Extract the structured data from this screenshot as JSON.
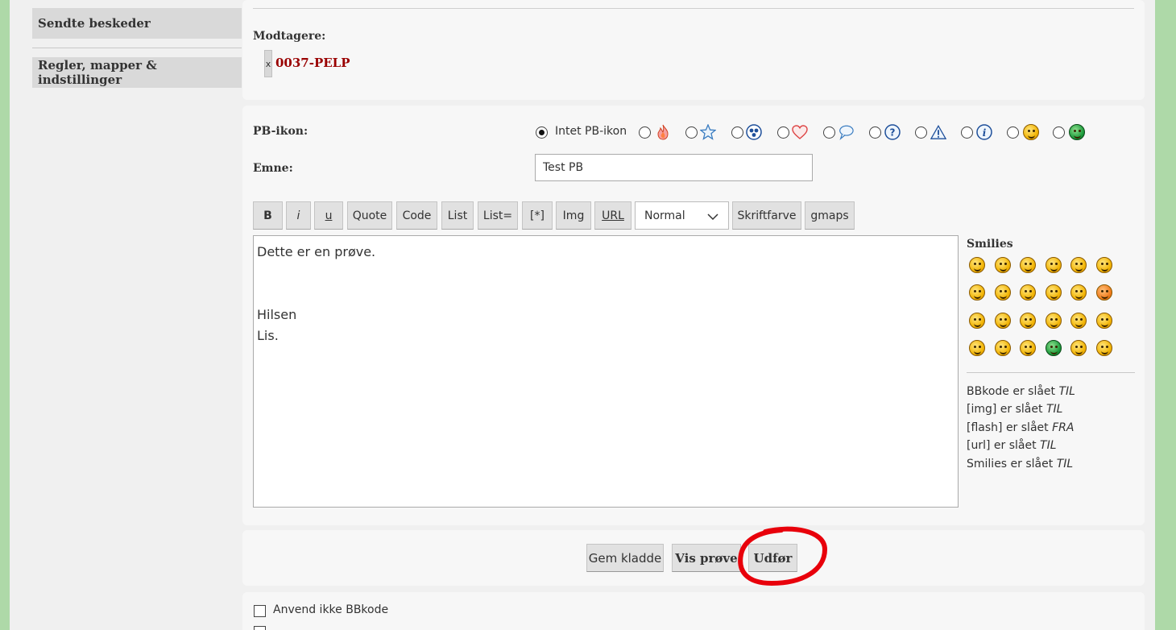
{
  "sidebar": {
    "items": [
      {
        "label": "Sendte beskeder"
      },
      {
        "label": "Regler, mapper & indstillinger"
      }
    ]
  },
  "recipients": {
    "label": "Modtagere:",
    "remove_symbol": "x",
    "items": [
      {
        "name": "0037-PELP",
        "color": "#990000"
      }
    ]
  },
  "pm_icon": {
    "label": "PB-ikon:",
    "none_label": "Intet PB-ikon",
    "selected": "none",
    "icons": [
      "fire-icon",
      "star-icon",
      "radioactive-icon",
      "heart-icon",
      "speech-bubble-icon",
      "question-icon",
      "warning-icon",
      "info-icon",
      "smiley-icon",
      "green-grin-icon"
    ]
  },
  "subject": {
    "label": "Emne:",
    "value": "Test PB"
  },
  "toolbar": {
    "bold": "B",
    "italic": "i",
    "underline": "u",
    "quote": "Quote",
    "code": "Code",
    "list": "List",
    "list_ordered": "List=",
    "list_item": "[*]",
    "img": "Img",
    "url": "URL",
    "font_size": "Normal",
    "font_color": "Skriftfarve",
    "gmaps": "gmaps"
  },
  "message": {
    "lines": [
      "Dette er en prøve.",
      "",
      "",
      "Hilsen",
      "Lis."
    ]
  },
  "smilies": {
    "label": "Smilies",
    "rows": [
      [
        "laugh",
        "smile",
        "wink",
        "sad",
        "surprised",
        "eek"
      ],
      [
        "confused",
        "cool",
        "lol",
        "mad",
        "razz",
        "redface"
      ],
      [
        "cry",
        "evil",
        "twisted",
        "rolleyes",
        "exclaim",
        "question"
      ],
      [
        "idea",
        "arrow",
        "neutral",
        "mrgreen",
        "geek",
        "ugeek"
      ]
    ]
  },
  "status": [
    {
      "text": "BBkode er slået ",
      "state": "TIL"
    },
    {
      "text": "[img] er slået ",
      "state": "TIL"
    },
    {
      "text": "[flash] er slået ",
      "state": "FRA"
    },
    {
      "text": "[url] er slået ",
      "state": "TIL"
    },
    {
      "text": "Smilies er slået ",
      "state": "TIL"
    }
  ],
  "actions": {
    "save_draft": "Gem kladde",
    "preview": "Vis prøve",
    "submit": "Udfør",
    "highlight_color": "#e8000b"
  },
  "options": [
    {
      "label": "Anvend ikke BBkode",
      "checked": false
    }
  ]
}
